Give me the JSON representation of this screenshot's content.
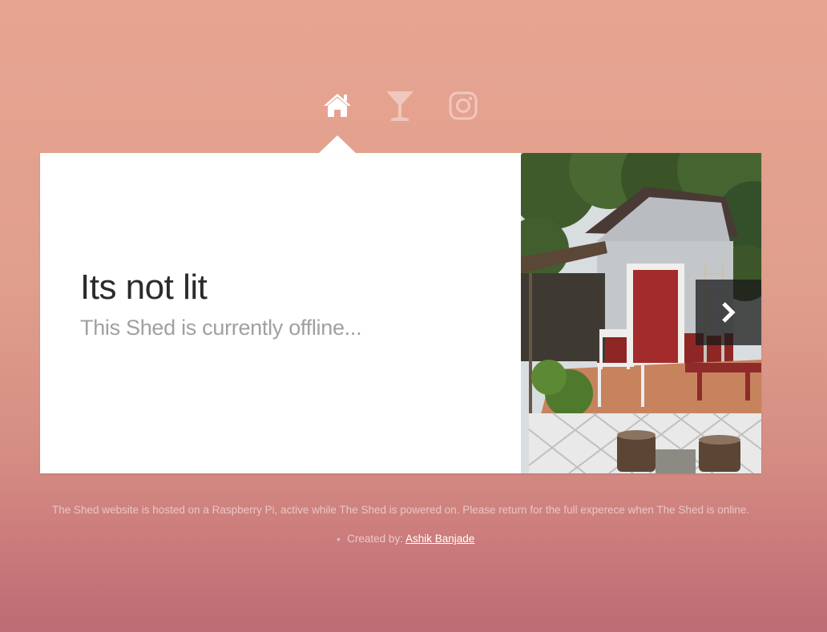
{
  "nav": {
    "items": [
      {
        "icon": "home-icon",
        "active": true
      },
      {
        "icon": "cocktail-icon",
        "active": false
      },
      {
        "icon": "instagram-icon",
        "active": false
      }
    ]
  },
  "card": {
    "title": "Its not lit",
    "subtitle": "This Shed is currently offline...",
    "slide_icon": "next-arrow-icon"
  },
  "footer": {
    "note": "The Shed website is hosted on a Raspberry Pi, active while The Shed is powered on. Please return for the full experece when The Shed is online.",
    "credit_prefix": "Created by:",
    "author": "Ashik Banjade"
  },
  "colors": {
    "background_top": "#e6a491",
    "background_bottom": "#bd6b75",
    "card": "#ffffff",
    "title": "#2b2b2b",
    "subtitle": "#a0a0a0"
  }
}
